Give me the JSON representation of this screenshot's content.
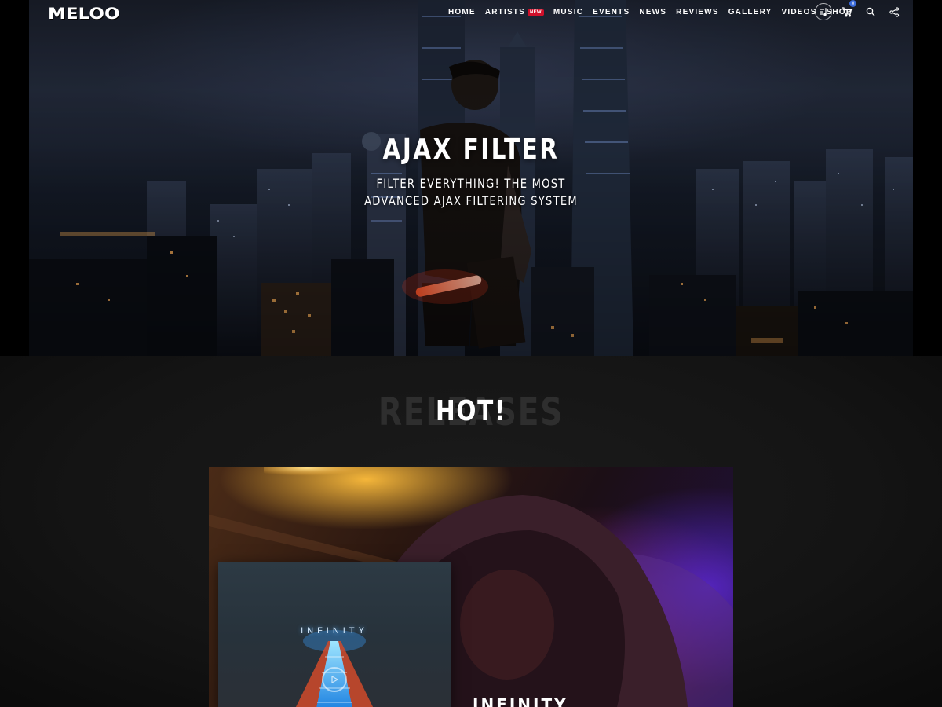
{
  "brand": {
    "logo_text": "MELOO"
  },
  "nav": {
    "items": [
      {
        "label": "HOME"
      },
      {
        "label": "ARTISTS",
        "badge": "NEW"
      },
      {
        "label": "MUSIC"
      },
      {
        "label": "EVENTS"
      },
      {
        "label": "NEWS"
      },
      {
        "label": "REVIEWS"
      },
      {
        "label": "GALLERY"
      },
      {
        "label": "VIDEOS"
      },
      {
        "label": "SHOP"
      }
    ],
    "icons": {
      "playlist": "playlist-icon",
      "cart": "cart-icon",
      "search": "search-icon",
      "share": "share-icon"
    },
    "cart_count": "0"
  },
  "hero": {
    "title": "AJAX FILTER",
    "subtitle_line1": "FILTER EVERYTHING! THE MOST",
    "subtitle_line2": "ADVANCED AJAX FILTERING SYSTEM"
  },
  "section": {
    "background_text": "RELEASES",
    "title": "HOT!"
  },
  "release": {
    "album_cover_title": "INFINITY",
    "name": "INFINITY"
  },
  "colors": {
    "accent_badge": "#d0102a",
    "cart_badge": "#3a6bdc",
    "background": "#141414"
  }
}
